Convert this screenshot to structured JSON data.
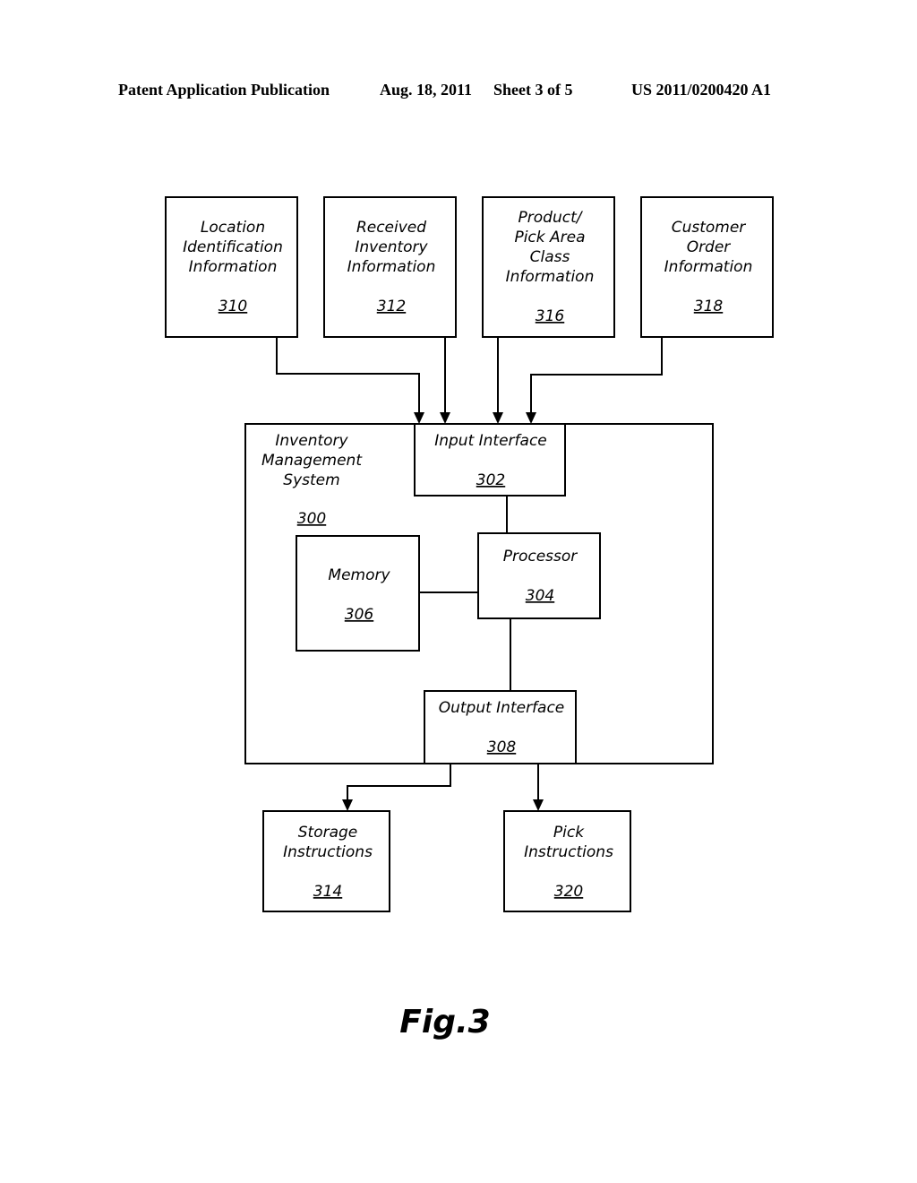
{
  "header": {
    "publication": "Patent Application Publication",
    "date": "Aug. 18, 2011",
    "sheet": "Sheet 3 of 5",
    "number": "US 2011/0200420 A1"
  },
  "figure_label": "Fig.3",
  "nodes": {
    "location": {
      "lines": [
        "Location",
        "Identification",
        "Information"
      ],
      "ref": "310"
    },
    "received": {
      "lines": [
        "Received",
        "Inventory",
        "Information"
      ],
      "ref": "312"
    },
    "product": {
      "lines": [
        "Product/",
        "Pick Area",
        "Class",
        "Information"
      ],
      "ref": "316"
    },
    "customer": {
      "lines": [
        "Customer",
        "Order",
        "Information"
      ],
      "ref": "318"
    },
    "ims": {
      "lines": [
        "Inventory",
        "Management",
        "System"
      ],
      "ref": "300"
    },
    "input": {
      "lines": [
        "Input Interface"
      ],
      "ref": "302"
    },
    "processor": {
      "lines": [
        "Processor"
      ],
      "ref": "304"
    },
    "memory": {
      "lines": [
        "Memory"
      ],
      "ref": "306"
    },
    "output": {
      "lines": [
        "Output Interface"
      ],
      "ref": "308"
    },
    "storage": {
      "lines": [
        "Storage",
        "Instructions"
      ],
      "ref": "314"
    },
    "pick": {
      "lines": [
        "Pick",
        "Instructions"
      ],
      "ref": "320"
    }
  },
  "edges": [
    {
      "from": "310",
      "to": "302",
      "arrow": true
    },
    {
      "from": "312",
      "to": "302",
      "arrow": true
    },
    {
      "from": "316",
      "to": "302",
      "arrow": true
    },
    {
      "from": "318",
      "to": "302",
      "arrow": true
    },
    {
      "from": "302",
      "to": "304",
      "arrow": false
    },
    {
      "from": "306",
      "to": "304",
      "arrow": false
    },
    {
      "from": "304",
      "to": "308",
      "arrow": false
    },
    {
      "from": "308",
      "to": "314",
      "arrow": true
    },
    {
      "from": "308",
      "to": "320",
      "arrow": true
    }
  ]
}
